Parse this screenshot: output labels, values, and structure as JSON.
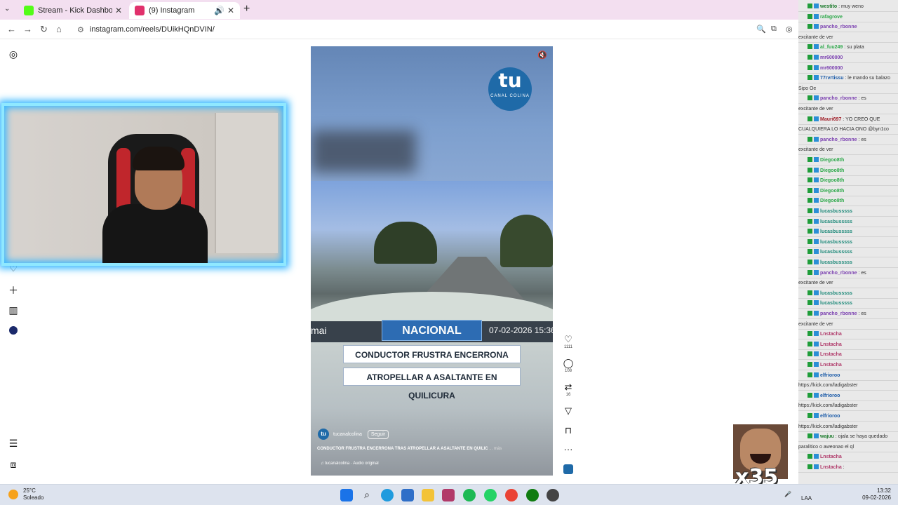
{
  "browser": {
    "tabs": [
      {
        "title": "Stream - Kick Dashboard",
        "active": false,
        "favicon_color": "#53fc18"
      },
      {
        "title": "(9) Instagram",
        "active": true,
        "favicon_color": "#e1306c"
      }
    ],
    "url": "instagram.com/reels/DUikHQnDVIN/"
  },
  "reel": {
    "logo_text": "tu",
    "logo_sub": "CANAL COLINA",
    "ticker_left": "mai",
    "tag": "NACIONAL",
    "date": "07-02-2026 15:36",
    "headline_1": "CONDUCTOR FRUSTRA ENCERRONA TRAS",
    "headline_2": "ATROPELLAR A ASALTANTE EN QUILICURA",
    "username": "tucanalcolina",
    "follow_label": "Seguir",
    "caption": "CONDUCTOR FRUSTRA ENCERRONA TRAS ATROPELLAR A ASALTANTE EN QUILIC",
    "caption_more": "... más",
    "audio": "♫ tucanalcolina · Audio original"
  },
  "actions": {
    "likes": "1111",
    "comments": "108",
    "reposts": "16"
  },
  "chat": {
    "rows": [
      {
        "user": "westito",
        "msg": ": muy weno",
        "color": "#1a7a2a"
      },
      {
        "user": "rafagrove",
        "msg": "",
        "color": "#2da84a"
      },
      {
        "user": "pancho_rbonne",
        "msg": "",
        "color": "#7a3fb0"
      },
      {
        "user": "",
        "msg": "excitante de ver",
        "color": "#333333"
      },
      {
        "user": "al_fuu249",
        "msg": ": su plata",
        "color": "#2da84a"
      },
      {
        "user": "mr600000",
        "msg": "",
        "color": "#7a3fb0"
      },
      {
        "user": "mr600000",
        "msg": "",
        "color": "#7a3fb0"
      },
      {
        "user": "77rvrtissu",
        "msg": ": le mando su balazo",
        "color": "#1a5aa8"
      },
      {
        "user": "",
        "msg": "Sipo Oe",
        "color": "#333333"
      },
      {
        "user": "pancho_rbonne",
        "msg": ": es",
        "color": "#7a3fb0"
      },
      {
        "user": "",
        "msg": "excitante de ver",
        "color": "#333333"
      },
      {
        "user": "Mauri697",
        "msg": ": YO CREO QUE",
        "color": "#a0202a"
      },
      {
        "user": "",
        "msg": "CUALQUIERA LO HACIA ONO @byn1co",
        "color": "#333333"
      },
      {
        "user": "pancho_rbonne",
        "msg": ": es",
        "color": "#7a3fb0"
      },
      {
        "user": "",
        "msg": "excitante de ver",
        "color": "#333333"
      },
      {
        "user": "Diegoo8th",
        "msg": "",
        "color": "#2da84a"
      },
      {
        "user": "Diegoo8th",
        "msg": "",
        "color": "#2da84a"
      },
      {
        "user": "Diegoo8th",
        "msg": "",
        "color": "#2da84a"
      },
      {
        "user": "Diegoo8th",
        "msg": "",
        "color": "#2da84a"
      },
      {
        "user": "Diegoo8th",
        "msg": "",
        "color": "#2da84a"
      },
      {
        "user": "lucasbusssss",
        "msg": "",
        "color": "#1f8a7a"
      },
      {
        "user": "lucasbusssss",
        "msg": "",
        "color": "#1f8a7a"
      },
      {
        "user": "lucasbusssss",
        "msg": "",
        "color": "#1f8a7a"
      },
      {
        "user": "lucasbusssss",
        "msg": "",
        "color": "#1f8a7a"
      },
      {
        "user": "lucasbusssss",
        "msg": "",
        "color": "#1f8a7a"
      },
      {
        "user": "lucasbusssss",
        "msg": "",
        "color": "#1f8a7a"
      },
      {
        "user": "pancho_rbonne",
        "msg": ": es",
        "color": "#7a3fb0"
      },
      {
        "user": "",
        "msg": "excitante de ver",
        "color": "#333333"
      },
      {
        "user": "lucasbusssss",
        "msg": "",
        "color": "#1f8a7a"
      },
      {
        "user": "lucasbusssss",
        "msg": "",
        "color": "#1f8a7a"
      },
      {
        "user": "pancho_rbonne",
        "msg": ": es",
        "color": "#7a3fb0"
      },
      {
        "user": "",
        "msg": "excitante de ver",
        "color": "#333333"
      },
      {
        "user": "Lnstacha",
        "msg": "",
        "color": "#b03a6a"
      },
      {
        "user": "Lnstacha",
        "msg": "",
        "color": "#b03a6a"
      },
      {
        "user": "Lnstacha",
        "msg": "",
        "color": "#b03a6a"
      },
      {
        "user": "Lnstacha",
        "msg": "",
        "color": "#b03a6a"
      },
      {
        "user": "elfrioroo",
        "msg": "",
        "color": "#1a5aa8"
      },
      {
        "user": "",
        "msg": "https://kick.com/ladigabster",
        "color": "#333333"
      },
      {
        "user": "elfrioroo",
        "msg": "",
        "color": "#1a5aa8"
      },
      {
        "user": "",
        "msg": "https://kick.com/ladigabster",
        "color": "#333333"
      },
      {
        "user": "elfrioroo",
        "msg": "",
        "color": "#1a5aa8"
      },
      {
        "user": "",
        "msg": "https://kick.com/ladigabster",
        "color": "#333333"
      },
      {
        "user": "wajuu",
        "msg": ": ojala se haya quedado",
        "color": "#1a7a2a"
      },
      {
        "user": "",
        "msg": "paralitico o aweonao el ql",
        "color": "#333333"
      },
      {
        "user": "Lnstacha",
        "msg": "",
        "color": "#b03a6a"
      },
      {
        "user": "Lnstacha",
        "msg": ":",
        "color": "#b03a6a"
      }
    ],
    "gif_label": "x35"
  },
  "taskbar": {
    "temp": "25°C",
    "weather": "Soleado",
    "lang": "LAA",
    "time": "13:32",
    "date": "09-02-2026"
  }
}
